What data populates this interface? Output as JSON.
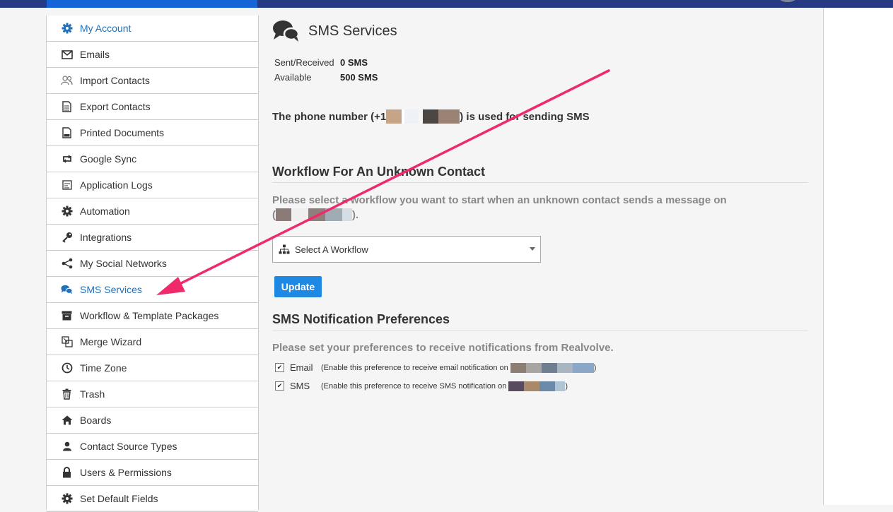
{
  "sidebar": {
    "items": [
      {
        "label": "My Account",
        "icon": "gear-icon",
        "active": true
      },
      {
        "label": "Emails",
        "icon": "envelope-icon"
      },
      {
        "label": "Import Contacts",
        "icon": "users-icon"
      },
      {
        "label": "Export Contacts",
        "icon": "document-icon"
      },
      {
        "label": "Printed Documents",
        "icon": "pdf-icon"
      },
      {
        "label": "Google Sync",
        "icon": "sync-icon"
      },
      {
        "label": "Application Logs",
        "icon": "log-icon"
      },
      {
        "label": "Automation",
        "icon": "gear-icon"
      },
      {
        "label": "Integrations",
        "icon": "key-icon"
      },
      {
        "label": "My Social Networks",
        "icon": "share-icon"
      },
      {
        "label": "SMS Services",
        "icon": "chat-bubbles-icon",
        "active": true
      },
      {
        "label": "Workflow & Template Packages",
        "icon": "archive-icon"
      },
      {
        "label": "Merge Wizard",
        "icon": "merge-icon"
      },
      {
        "label": "Time Zone",
        "icon": "clock-icon"
      },
      {
        "label": "Trash",
        "icon": "trash-icon"
      },
      {
        "label": "Boards",
        "icon": "home-icon"
      },
      {
        "label": "Contact Source Types",
        "icon": "user-icon"
      },
      {
        "label": "Users & Permissions",
        "icon": "lock-icon"
      },
      {
        "label": "Set Default Fields",
        "icon": "gear-icon"
      }
    ]
  },
  "main": {
    "title": "SMS Services",
    "stats": {
      "sent_label": "Sent/Received",
      "sent_value": "0 SMS",
      "available_label": "Available",
      "available_value": "500 SMS"
    },
    "phone": {
      "prefix": "The phone number (+1",
      "suffix": ") is used for sending SMS"
    },
    "workflow": {
      "title": "Workflow For An Unknown Contact",
      "desc_line1": "Please select a workflow you want to start when an unknown contact sends a message on",
      "desc_open": "(",
      "desc_close": ").",
      "select_value": "Select A Workflow",
      "update_label": "Update"
    },
    "notifications": {
      "title": "SMS Notification Preferences",
      "desc": "Please set your preferences to receive notifications from Realvolve.",
      "email_label": "Email",
      "email_note": "(Enable this preference to receive email notification on",
      "email_close": ")",
      "sms_label": "SMS",
      "sms_note": "(Enable this preference to receive SMS notification on",
      "sms_close": ")",
      "email_checked": true,
      "sms_checked": true
    }
  },
  "colors": {
    "topbar": "#263a84",
    "accent": "#1565d8",
    "active_link": "#1f71ba",
    "button": "#1e88e5",
    "arrow": "#ee2a6b"
  }
}
